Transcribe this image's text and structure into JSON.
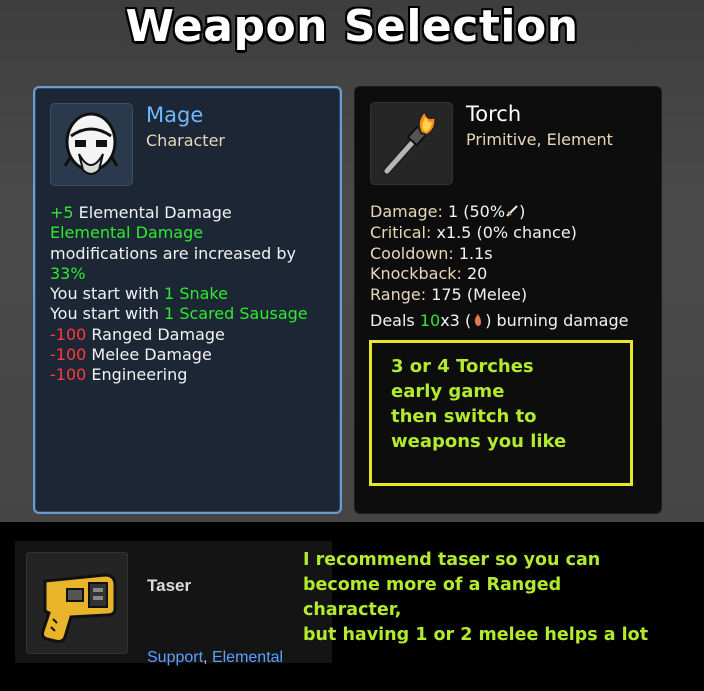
{
  "title": "Weapon Selection",
  "character": {
    "icon": "mage-portrait-icon",
    "name": "Mage",
    "type": "Character",
    "effects": [
      {
        "value": "+5",
        "text": " Elemental Damage"
      },
      {
        "highlight": "Elemental Damage",
        "text": "modifications are increased by",
        "value": "33%"
      },
      {
        "text": "You start with ",
        "value": "1 Snake"
      },
      {
        "text": "You start with ",
        "value": "1 Scared Sausage"
      },
      {
        "value": "-100",
        "text": " Ranged Damage"
      },
      {
        "value": "-100",
        "text": " Melee Damage"
      },
      {
        "value": "-100",
        "text": " Engineering"
      }
    ]
  },
  "weapon": {
    "icon": "torch-icon",
    "name": "Torch",
    "tags": "Primitive, Element",
    "stats": [
      {
        "label": "Damage:",
        "value": " 1 (50%",
        "icon": "sword-icon",
        "suffix": ")"
      },
      {
        "label": "Critical:",
        "value": " x1.5 (0% chance)"
      },
      {
        "label": "Cooldown:",
        "value": " 1.1s"
      },
      {
        "label": "Knockback:",
        "value": " 20"
      },
      {
        "label": "Range:",
        "value": " 175 (Melee)"
      }
    ],
    "burn": {
      "prefix": "Deals ",
      "value": "10",
      "mult": "x3",
      "icon": "flame-icon",
      "suffix": " burning damage"
    }
  },
  "torch_note": [
    "3 or 4 Torches",
    "early game",
    "then switch to",
    "weapons you like"
  ],
  "taser": {
    "icon": "taser-icon",
    "name": "Taser",
    "tag1": "Support",
    "sep": ", ",
    "tag2": "Elemental"
  },
  "recommendation": [
    "I recommend taser so you can",
    "become more of a Ranged",
    "character,",
    "but having 1 or 2 melee helps a lot"
  ],
  "colors": {
    "positive": "#2eea2e",
    "negative": "#ff3b3b",
    "note": "#b2ea2e",
    "highlight_border": "#e8e82a",
    "character_name": "#6fb7ff"
  }
}
